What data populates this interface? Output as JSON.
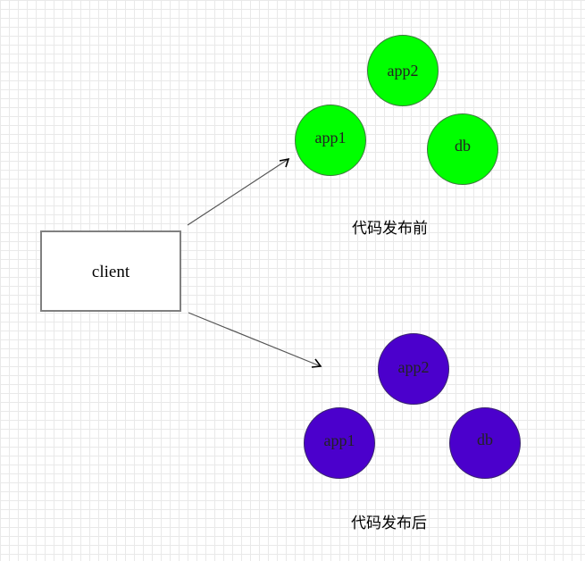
{
  "client": {
    "label": "client"
  },
  "before": {
    "caption": "代码发布前",
    "color": "#00ff00",
    "nodes": {
      "app2": "app2",
      "app1": "app1",
      "db": "db"
    }
  },
  "after": {
    "caption": "代码发布后",
    "color": "#4b00cc",
    "nodes": {
      "app2": "app2",
      "app1": "app1",
      "db": "db"
    }
  }
}
